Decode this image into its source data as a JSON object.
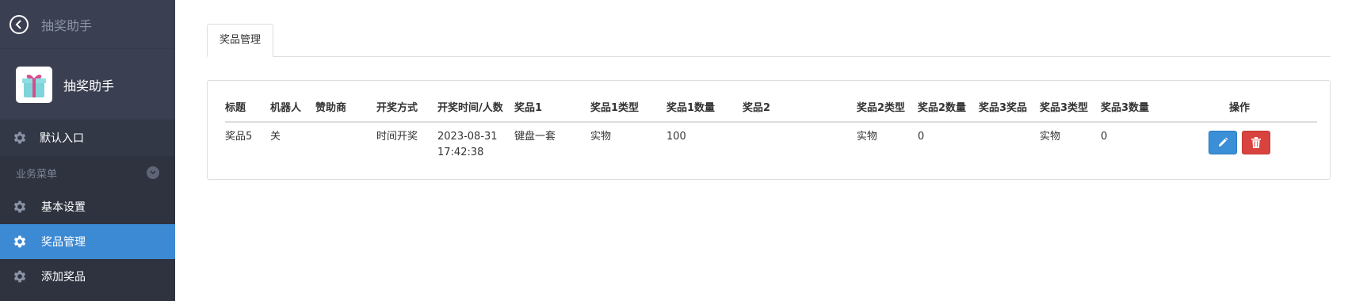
{
  "sidebar": {
    "top_title": "抽奖助手",
    "app_name": "抽奖助手",
    "default_entry": "默认入口",
    "section_label": "业务菜单",
    "items": [
      {
        "label": "基本设置",
        "active": false
      },
      {
        "label": "奖品管理",
        "active": true
      },
      {
        "label": "添加奖品",
        "active": false
      }
    ]
  },
  "tabs": [
    {
      "label": "奖品管理"
    }
  ],
  "table": {
    "headers": [
      "标题",
      "机器人",
      "赞助商",
      "开奖方式",
      "开奖时间/人数",
      "奖品1",
      "奖品1类型",
      "奖品1数量",
      "奖品2",
      "奖品2类型",
      "奖品2数量",
      "奖品3奖品",
      "奖品3类型",
      "奖品3数量",
      "操作"
    ],
    "rows": [
      {
        "title": "奖品5",
        "robot": "关",
        "sponsor": "",
        "draw_method": "时间开奖",
        "draw_date": "2023-08-31",
        "draw_time": "17:42:38",
        "prize1": "键盘一套",
        "prize1_type": "实物",
        "prize1_count": "100",
        "prize2": "",
        "prize2_type": "实物",
        "prize2_count": "0",
        "prize3": "",
        "prize3_type": "实物",
        "prize3_count": "0"
      }
    ]
  },
  "colors": {
    "sidebar_bg": "#2f3340",
    "sidebar_header_bg": "#3a3f51",
    "active_item": "#3d8ad4",
    "edit_button": "#3b8fd6",
    "delete_button": "#d9433f"
  },
  "icons": {
    "back": "back-circle-icon",
    "logo": "gift-icon",
    "menu": "gear-icon",
    "section": "chevron-down-icon",
    "edit": "pencil-icon",
    "delete": "trash-icon"
  }
}
